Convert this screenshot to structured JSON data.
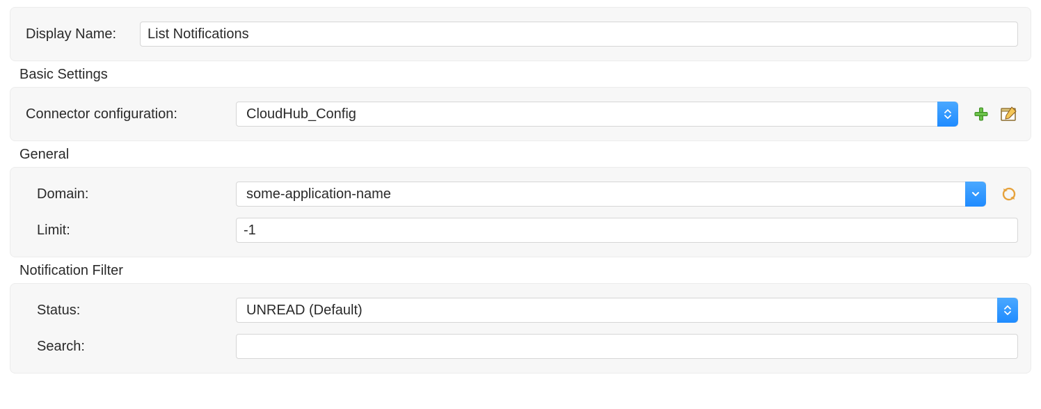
{
  "header": {
    "display_name_label": "Display Name:",
    "display_name_value": "List Notifications"
  },
  "basic_settings": {
    "title": "Basic Settings",
    "connector_label": "Connector configuration:",
    "connector_value": "CloudHub_Config"
  },
  "general": {
    "title": "General",
    "domain_label": "Domain:",
    "domain_value": "some-application-name",
    "limit_label": "Limit:",
    "limit_value": "-1"
  },
  "notification_filter": {
    "title": "Notification Filter",
    "status_label": "Status:",
    "status_value": "UNREAD (Default)",
    "search_label": "Search:",
    "search_value": ""
  },
  "icons": {
    "add": "plus-icon",
    "edit": "edit-icon",
    "refresh": "refresh-icon"
  }
}
